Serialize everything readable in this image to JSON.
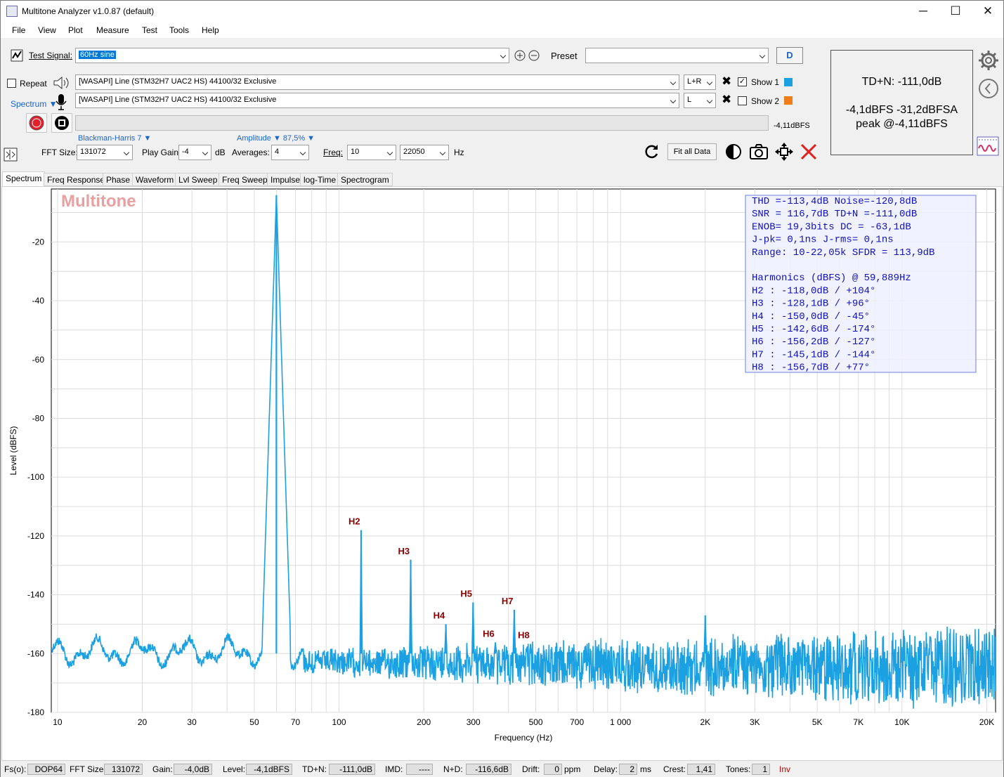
{
  "window": {
    "title": "Multitone Analyzer v1.0.87 (default)",
    "minimize": "─",
    "maximize": "☐",
    "close": "✕"
  },
  "menu": [
    "File",
    "View",
    "Plot",
    "Measure",
    "Test",
    "Tools",
    "Help"
  ],
  "toolbar": {
    "test_signal_label": "Test Signal:",
    "test_signal_value": "60Hz sine",
    "preset_label": "Preset",
    "preset_value": "",
    "d_button": "D",
    "repeat_label": "Repeat",
    "output_device": "[WASAPI] Line (STM32H7 UAC2 HS) 44100/32 Exclusive",
    "output_channel": "L+R",
    "input_device": "[WASAPI] Line (STM32H7 UAC2 HS) 44100/32 Exclusive",
    "input_channel": "L",
    "show1_label": "Show 1",
    "show1_checked": true,
    "show1_color": "#1ba1e2",
    "show2_label": "Show 2",
    "show2_checked": false,
    "show2_color": "#f07e18",
    "spectrum_label": "Spectrum ▼",
    "level_readout": "-4,11dBFS",
    "window_label": "Blackman-Harris 7 ▼",
    "amplitude_label": "Amplitude ▼ 87,5% ▼",
    "fft_size_label": "FFT Size:",
    "fft_size": "131072",
    "play_gain_label": "Play Gain:",
    "play_gain": "-4",
    "play_gain_unit": "dB",
    "averages_label": "Averages:",
    "averages": "4",
    "freq_label": "Freq:",
    "freq_from": "10",
    "freq_to": "22050",
    "freq_unit": "Hz",
    "fit_all_label": "Fit all Data"
  },
  "readout": {
    "line1": "TD+N: -111,0dB",
    "line2": "-4,1dBFS  -31,2dBFSA",
    "line3": "peak @-4,11dBFS"
  },
  "tabs": [
    "Spectrum",
    "Freq Response",
    "Phase",
    "Waveform",
    "Lvl Sweep",
    "Freq Sweep",
    "Impulse",
    "log-Time",
    "Spectrogram"
  ],
  "watermark": "Multitone",
  "stats_lines": [
    "THD =-113,4dB     Noise=-120,8dB",
    "SNR = 116,7dB     TD+N =-111,0dB",
    "ENOB=  19,3bits   DC   = -63,1dB",
    "J-pk=   0,1ns     J-rms=   0,1ns",
    "Range: 10-22,05k  SFDR = 113,9dB",
    "",
    "Harmonics (dBFS) @ 59,889Hz",
    "H2 :  -118,0dB / +104°",
    "H3 :  -128,1dB /  +96°",
    "H4 :  -150,0dB /  -45°",
    "H5 :  -142,6dB / -174°",
    "H6 :  -156,2dB / -127°",
    "H7 :  -145,1dB / -144°",
    "H8 :  -156,7dB /  +77°"
  ],
  "chart_data": {
    "type": "line",
    "xlabel": "Frequency (Hz)",
    "ylabel": "Level (dBFS)",
    "x_scale": "log",
    "xlim": [
      9.5,
      21500
    ],
    "ylim": [
      -180,
      -2
    ],
    "grid": true,
    "y_ticks": [
      -20,
      -40,
      -60,
      -80,
      -100,
      -120,
      -140,
      -160,
      -180
    ],
    "x_ticks": [
      {
        "v": 10,
        "t": "10"
      },
      {
        "v": 20,
        "t": "20"
      },
      {
        "v": 30,
        "t": "30"
      },
      {
        "v": 50,
        "t": "50"
      },
      {
        "v": 70,
        "t": "70"
      },
      {
        "v": 100,
        "t": "100"
      },
      {
        "v": 200,
        "t": "200"
      },
      {
        "v": 300,
        "t": "300"
      },
      {
        "v": 500,
        "t": "500"
      },
      {
        "v": 700,
        "t": "700"
      },
      {
        "v": 1000,
        "t": "1 000"
      },
      {
        "v": 2000,
        "t": "2K"
      },
      {
        "v": 3000,
        "t": "3K"
      },
      {
        "v": 5000,
        "t": "5K"
      },
      {
        "v": 7000,
        "t": "7K"
      },
      {
        "v": 10000,
        "t": "10K"
      },
      {
        "v": 20000,
        "t": "20K"
      }
    ],
    "series": [
      {
        "color": "#1ba1e2",
        "peaks": [
          {
            "x": 59.9,
            "y": -4.1
          },
          {
            "x": 119.8,
            "y": -118.0
          },
          {
            "x": 179.7,
            "y": -128.1
          },
          {
            "x": 239.6,
            "y": -150.0
          },
          {
            "x": 299.4,
            "y": -142.6
          },
          {
            "x": 359.3,
            "y": -156.2
          },
          {
            "x": 419.2,
            "y": -145.1
          },
          {
            "x": 479.1,
            "y": -156.7
          },
          {
            "x": 2000,
            "y": -147
          }
        ],
        "noise_floor": -160
      }
    ],
    "annotations": [
      {
        "label": "H2",
        "x": 119.8,
        "y": -118.0
      },
      {
        "label": "H3",
        "x": 179.7,
        "y": -128.1
      },
      {
        "label": "H4",
        "x": 239.6,
        "y": -150.0
      },
      {
        "label": "H5",
        "x": 299.4,
        "y": -142.6
      },
      {
        "label": "H6",
        "x": 359.3,
        "y": -156.2
      },
      {
        "label": "H7",
        "x": 419.2,
        "y": -145.1
      },
      {
        "label": "H8",
        "x": 479.1,
        "y": -156.7
      }
    ]
  },
  "status": {
    "fs_label": "Fs(o):",
    "fs": "DOP64",
    "fft_label": "FFT Size:",
    "fft": "131072",
    "gain_label": "Gain:",
    "gain": "-4,0dB",
    "level_label": "Level:",
    "level": "-4,1dBFS",
    "tdn_label": "TD+N:",
    "tdn": "-111,0dB",
    "imd_label": "IMD:",
    "imd": "----",
    "nd_label": "N+D:",
    "nd": "-116,6dB",
    "drift_label": "Drift:",
    "drift": "0",
    "drift_unit": "ppm",
    "delay_label": "Delay:",
    "delay": "2",
    "delay_unit": "ms",
    "crest_label": "Crest:",
    "crest": "1,41",
    "tones_label": "Tones:",
    "tones": "1",
    "inv": "Inv"
  }
}
